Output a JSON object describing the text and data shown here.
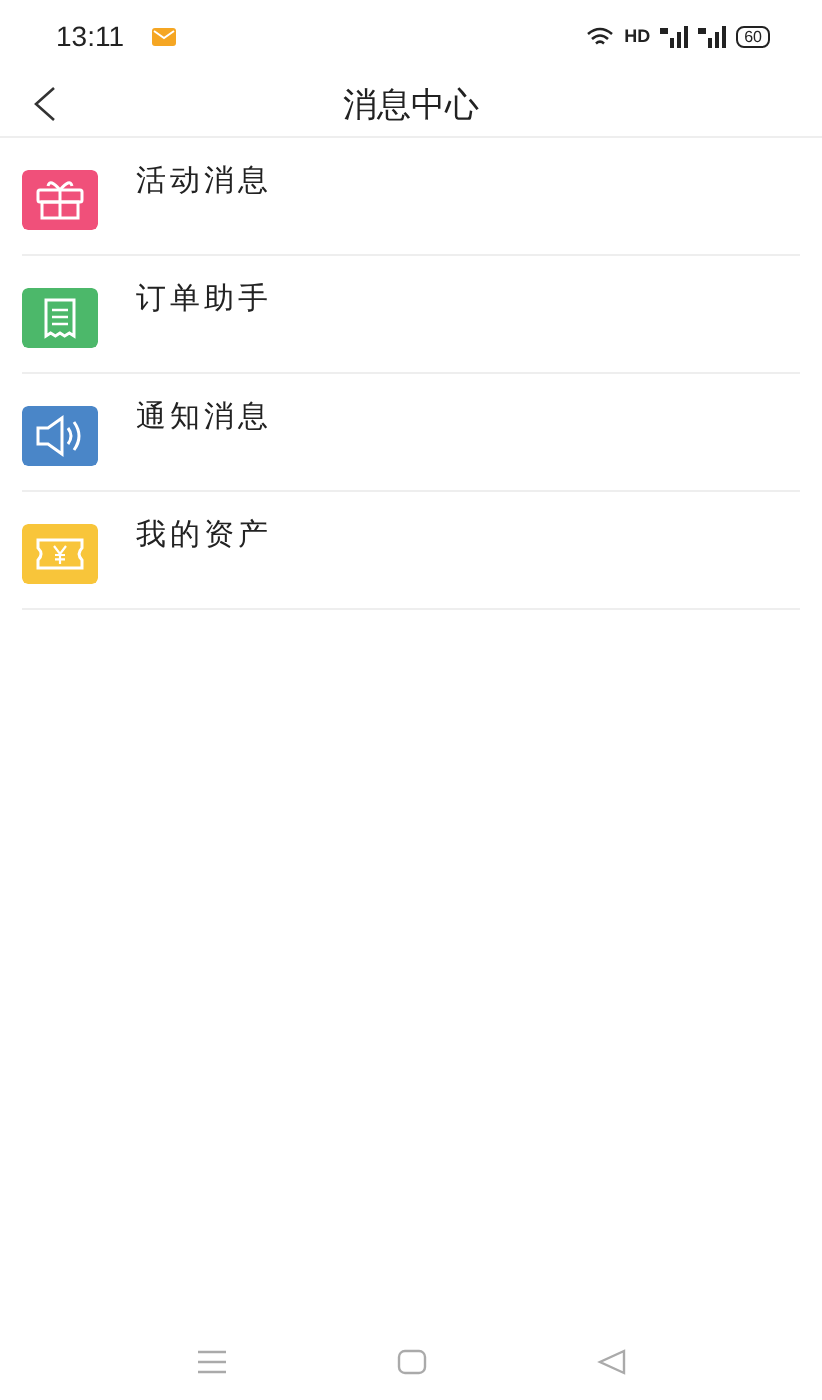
{
  "status_bar": {
    "time": "13:11",
    "network": "HD",
    "battery": "60"
  },
  "header": {
    "title": "消息中心"
  },
  "items": [
    {
      "label": "活动消息",
      "kind": "gift",
      "color": "#f0507a"
    },
    {
      "label": "订单助手",
      "kind": "receipt",
      "color": "#4cb86a"
    },
    {
      "label": "通知消息",
      "kind": "speaker",
      "color": "#4a86c8"
    },
    {
      "label": "我的资产",
      "kind": "ticket",
      "color": "#f8c53a"
    }
  ]
}
